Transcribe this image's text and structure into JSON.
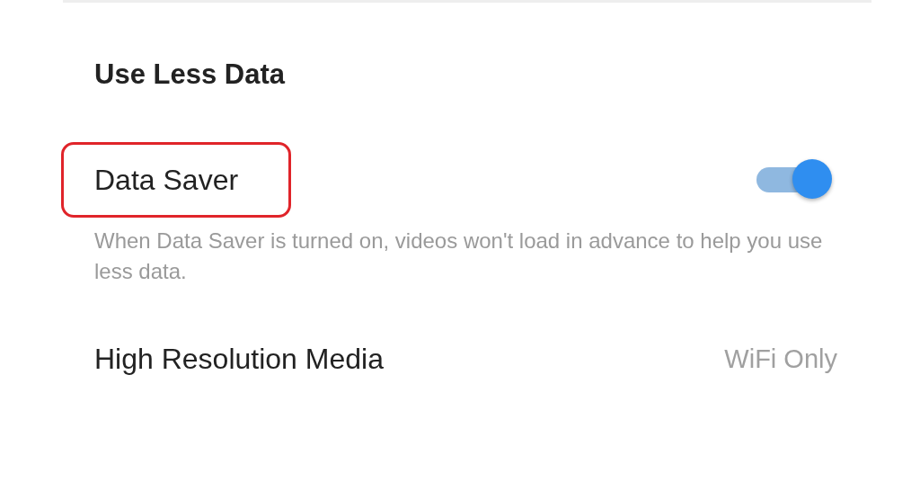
{
  "section": {
    "title": "Use Less Data"
  },
  "data_saver": {
    "label": "Data Saver",
    "highlighted": true,
    "on": true,
    "description": "When Data Saver is turned on, videos won't load in advance to help you use less data."
  },
  "high_resolution_media": {
    "label": "High Resolution Media",
    "value": "WiFi Only"
  }
}
